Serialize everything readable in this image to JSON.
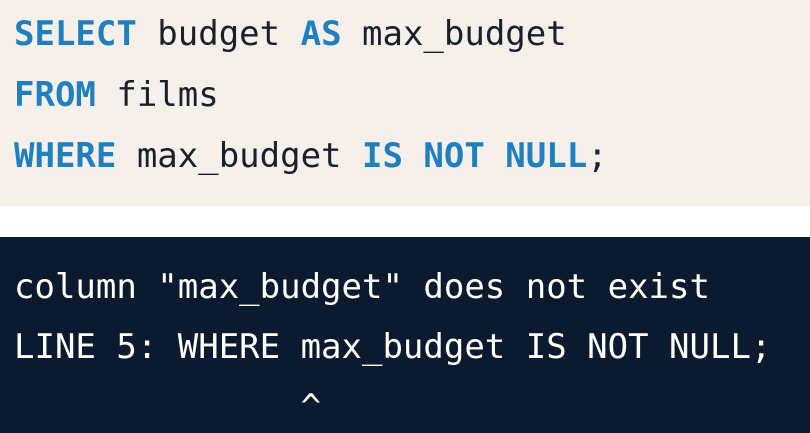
{
  "query": {
    "line1": {
      "kw1": "SELECT",
      "t1": " budget ",
      "kw2": "AS",
      "t2": " max_budget"
    },
    "line2": {
      "kw1": "FROM",
      "t1": " films"
    },
    "line3": {
      "kw1": "WHERE",
      "t1": " max_budget ",
      "kw2": "IS NOT NULL",
      "t2": ";"
    }
  },
  "error": {
    "message": "column \"max_budget\" does not exist",
    "line": "LINE 5: WHERE max_budget IS NOT NULL;",
    "caret": "              ^"
  },
  "colors": {
    "keyword": "#1f7fbf",
    "code_background": "#f5f0ea",
    "error_background": "#0b1a2e",
    "error_text": "#ffffff"
  }
}
